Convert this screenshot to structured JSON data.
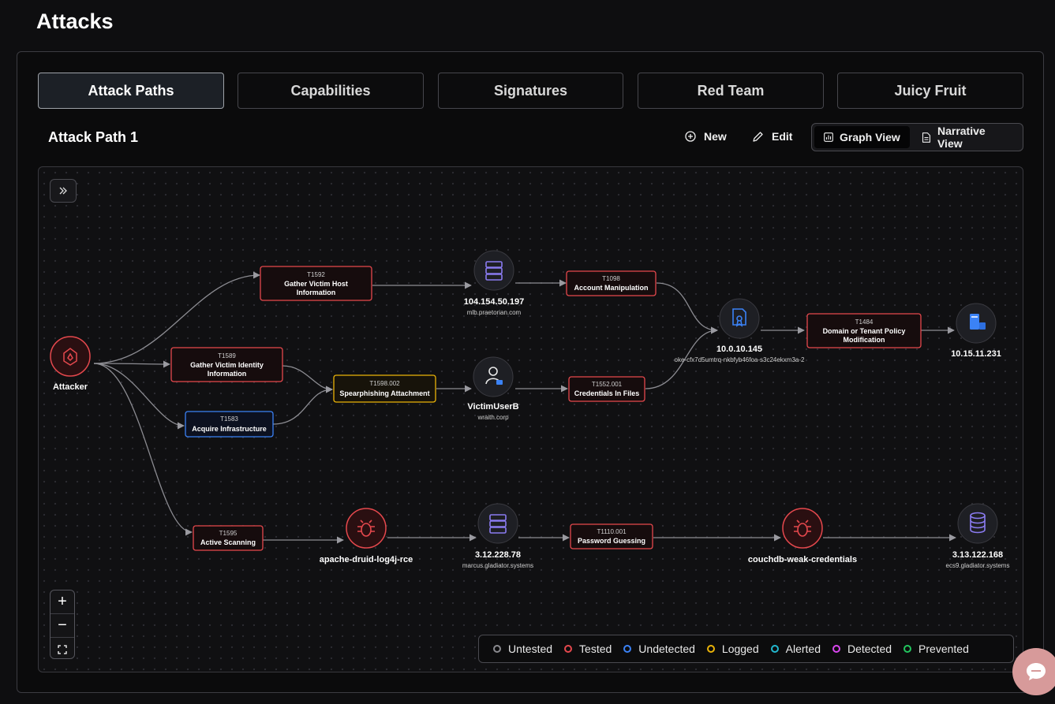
{
  "page": {
    "title": "Attacks"
  },
  "tabs": [
    {
      "label": "Attack Paths",
      "active": true
    },
    {
      "label": "Capabilities",
      "active": false
    },
    {
      "label": "Signatures",
      "active": false
    },
    {
      "label": "Red Team",
      "active": false
    },
    {
      "label": "Juicy Fruit",
      "active": false
    }
  ],
  "toolbar": {
    "path_title": "Attack Path 1",
    "new_label": "New",
    "edit_label": "Edit",
    "graph_view_label": "Graph View",
    "narrative_view_label": "Narrative View",
    "active_view": "Graph View"
  },
  "graph": {
    "attacker": {
      "label": "Attacker",
      "status": "Tested"
    },
    "techniques": [
      {
        "id": "T1592",
        "label_lines": [
          "Gather Victim Host",
          "Information"
        ],
        "status": "Tested"
      },
      {
        "id": "T1589",
        "label_lines": [
          "Gather Victim Identity",
          "Information"
        ],
        "status": "Tested"
      },
      {
        "id": "T1583",
        "label_lines": [
          "Acquire Infrastructure"
        ],
        "status": "Undetected"
      },
      {
        "id": "T1598.002",
        "label_lines": [
          "Spearphishing Attachment"
        ],
        "status": "Logged"
      },
      {
        "id": "T1098",
        "label_lines": [
          "Account Manipulation"
        ],
        "status": "Tested"
      },
      {
        "id": "T1552.001",
        "label_lines": [
          "Credentials In Files"
        ],
        "status": "Tested"
      },
      {
        "id": "T1484",
        "label_lines": [
          "Domain or Tenant Policy",
          "Modification"
        ],
        "status": "Tested"
      },
      {
        "id": "T1595",
        "label_lines": [
          "Active Scanning"
        ],
        "status": "Tested"
      },
      {
        "id": "T1110.001",
        "label_lines": [
          "Password Guessing"
        ],
        "status": "Tested"
      }
    ],
    "assets": [
      {
        "label": "104.154.50.197",
        "sub": "mlb.praetorian.com",
        "icon": "server-icon"
      },
      {
        "label": "VictimUserB",
        "sub": "wraith.corp",
        "icon": "user-icon"
      },
      {
        "label": "10.0.10.145",
        "sub": "oke-cfx7d5umtrq-nkbfyb46foa-s3c24ekxm3a-2",
        "icon": "certificate-icon"
      },
      {
        "label": "10.15.11.231",
        "sub": "",
        "icon": "directory-server-icon"
      },
      {
        "label": "3.12.228.78",
        "sub": "marcus.gladiator.systems",
        "icon": "server-icon"
      },
      {
        "label": "3.13.122.168",
        "sub": "ecs9.gladiator.systems",
        "icon": "database-icon"
      }
    ],
    "vulnerabilities": [
      {
        "label": "apache-druid-log4j-rce",
        "icon": "bug-icon"
      },
      {
        "label": "couchdb-weak-credentials",
        "icon": "bug-icon"
      }
    ]
  },
  "zoom_controls": {
    "zoom_in": "+",
    "zoom_out": "−",
    "fit": "⛶"
  },
  "legend": [
    {
      "label": "Untested",
      "color": "#8a8a8f"
    },
    {
      "label": "Tested",
      "color": "#e5484d"
    },
    {
      "label": "Undetected",
      "color": "#3b82f6"
    },
    {
      "label": "Logged",
      "color": "#eab308"
    },
    {
      "label": "Alerted",
      "color": "#22b8cf"
    },
    {
      "label": "Detected",
      "color": "#d946ef"
    },
    {
      "label": "Prevented",
      "color": "#22c55e"
    }
  ],
  "colors": {
    "background": "#0e0e10",
    "tested": "#e5484d",
    "undetected": "#3b82f6",
    "logged": "#eab308",
    "asset_accent": "#7b6cf0"
  }
}
